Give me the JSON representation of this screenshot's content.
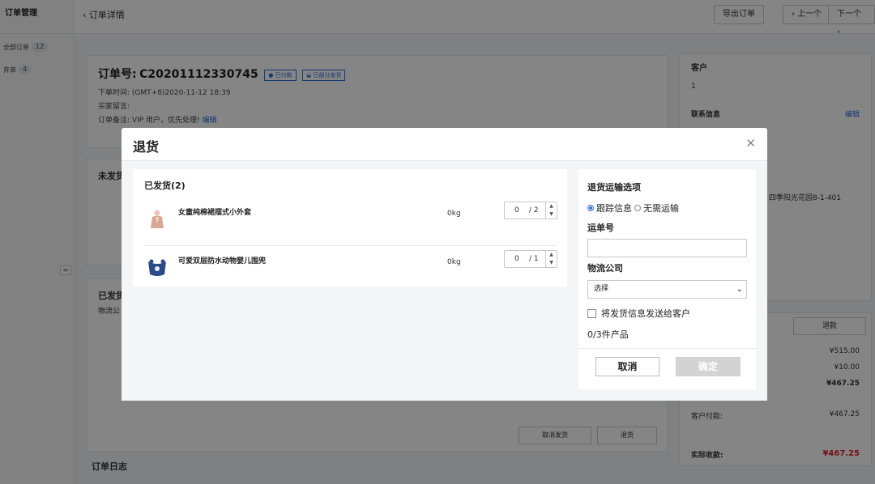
{
  "nav": {
    "title": "订单管理",
    "items": [
      {
        "label": "全部订单",
        "count": "12"
      },
      {
        "label": "弃单",
        "count": "4"
      }
    ]
  },
  "topbar": {
    "back_label": "订单详情",
    "export_label": "导出订单",
    "prev_label": "上一个",
    "next_label": "下一个"
  },
  "order": {
    "number_label": "订单号:",
    "number": "C20201112330745",
    "tags": [
      "已付款",
      "已部分发货"
    ],
    "time_label": "下单时间:",
    "time_value": "(GMT+8)2020-11-12 18:39",
    "message_label": "买家留言:",
    "note_label": "订单备注:",
    "note_value": "VIP 用户，优先处理!",
    "edit_label": "编辑"
  },
  "background_sections": {
    "unshipped": "未发货",
    "shipped": "已发货",
    "logistics": "物流公",
    "cancel_ship": "取消发货",
    "return": "退货",
    "order_log": "订单日志"
  },
  "sidebar": {
    "customer_label": "客户",
    "customer_value": "1",
    "contact_label": "联系信息",
    "edit_label": "编辑",
    "address_fragment": "四季阳光花园8-1-401",
    "refund_button": "退款",
    "amounts": [
      "¥515.00",
      "¥10.00",
      "¥467.25"
    ],
    "customer_paid_label": "客户付款:",
    "customer_paid_value": "¥467.25",
    "actual_label": "实际收款:",
    "actual_value": "¥467.25"
  },
  "modal": {
    "title": "退货",
    "shipped_header": "已发货(2)",
    "products": [
      {
        "name": "女童纯棉裙摆式小外套",
        "weight": "0kg",
        "qty": "0",
        "max": "/ 2"
      },
      {
        "name": "可爱双层防水动物婴儿围兜",
        "weight": "0kg",
        "qty": "0",
        "max": "/ 1"
      }
    ],
    "shipping_options_label": "退货运输选项",
    "option_tracking": "跟踪信息",
    "option_none": "无需运输",
    "tracking_no_label": "运单号",
    "tracking_no_value": "",
    "carrier_label": "物流公司",
    "carrier_selected": "选择",
    "notify_label": "将发货信息发送给客户",
    "product_count": "0/3件产品",
    "cancel_label": "取消",
    "confirm_label": "确定"
  },
  "colors": {
    "accent": "#2f6de0",
    "danger": "#e02030",
    "overlay": "rgba(0,0,0,0.48)"
  }
}
